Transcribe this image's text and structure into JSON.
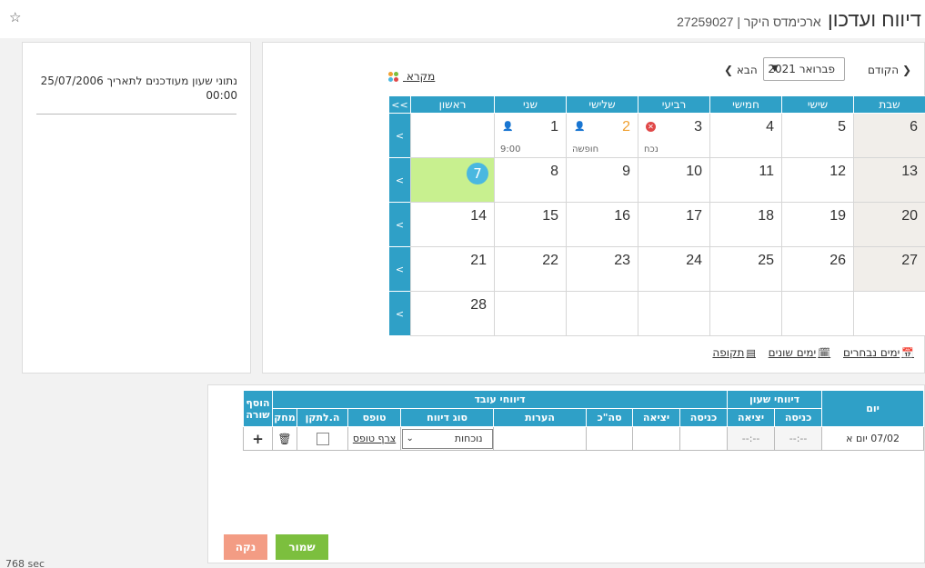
{
  "header": {
    "title": "דיווח ועדכון",
    "subtitle": "ארכימדס היקר | 27259027"
  },
  "info_panel": {
    "text": "נתוני שעון מעודכנים לתאריך 25/07/2006 00:00"
  },
  "calendar": {
    "prev_label": "הקודם",
    "month_value": "פברואר 2021",
    "next_label": "הבא",
    "legend_label": "מקרא",
    "expand_label": ">>",
    "row_arrow": ">",
    "weekdays": [
      "ראשון",
      "שני",
      "שלישי",
      "רביעי",
      "חמישי",
      "שישי",
      "שבת"
    ],
    "week1": {
      "mon": "1",
      "tue": "2",
      "wed": "3",
      "thu": "4",
      "fri": "5",
      "sat": "6",
      "mon_note": "9:00",
      "tue_note": "חופשה",
      "wed_note": "נכח"
    },
    "week2": {
      "sun": "7",
      "mon": "8",
      "tue": "9",
      "wed": "10",
      "thu": "11",
      "fri": "12",
      "sat": "13"
    },
    "week3": {
      "sun": "14",
      "mon": "15",
      "tue": "16",
      "wed": "17",
      "thu": "18",
      "fri": "19",
      "sat": "20"
    },
    "week4": {
      "sun": "21",
      "mon": "22",
      "tue": "23",
      "wed": "24",
      "thu": "25",
      "fri": "26",
      "sat": "27"
    },
    "week5": {
      "sun": "28"
    }
  },
  "bottom_links": {
    "selected_days": "ימים נבחרים",
    "various_days": "ימים שונים",
    "period": "תקופה"
  },
  "report": {
    "col_day": "יום",
    "group_clock": "דיווחי שעון",
    "group_employee": "דיווחי עובד",
    "col_add_row": "הוסף שורה",
    "col_entry": "כניסה",
    "col_exit": "יציאה",
    "col_total": "סה\"כ",
    "col_notes": "הערות",
    "col_report_type": "סוג דיווח",
    "col_form": "טופס",
    "col_to_fix": "ה.לתקן",
    "col_delete": "מחק",
    "row": {
      "day": "07/02 יום א",
      "clock_entry": "--:--",
      "clock_exit": "--:--",
      "report_type": "נוכחות",
      "form_link": "צרף טופס",
      "add": "+"
    }
  },
  "buttons": {
    "save": "שמור",
    "clear": "נקה"
  },
  "footer": {
    "timer": "768 sec"
  },
  "colors": {
    "accent": "#2fa0c7",
    "today": "#c8f08f",
    "save": "#7cbf3e",
    "clear": "#f39c84"
  }
}
